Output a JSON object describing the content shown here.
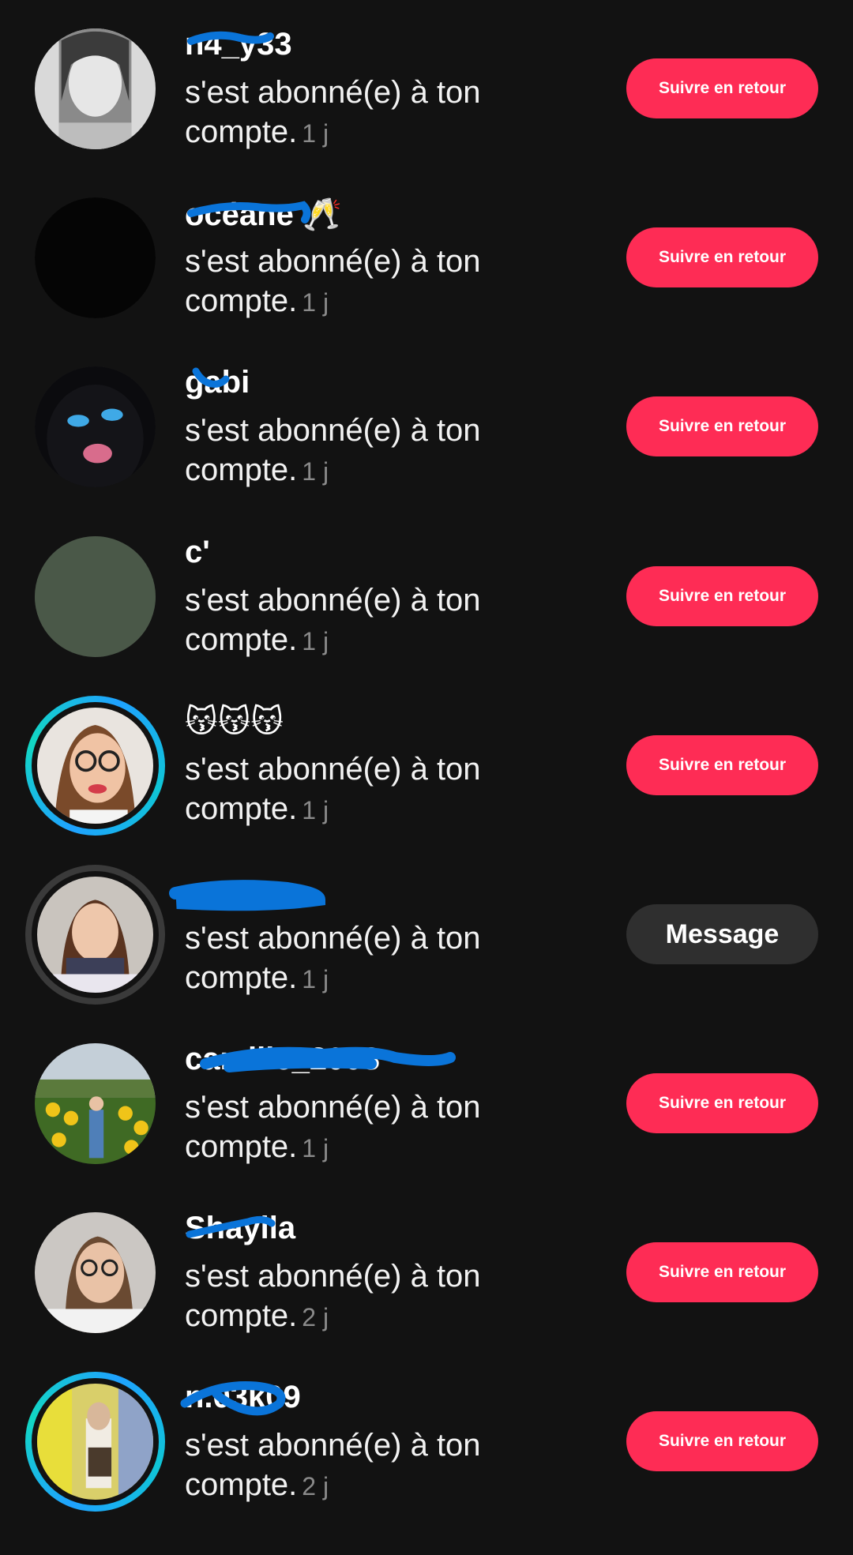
{
  "notifications": [
    {
      "username": "n4_y33",
      "action": "s'est abonné(e) à ton compte.",
      "time": "1 j",
      "button_label": "Suivre en retour",
      "button_type": "follow",
      "avatar_ring": "none"
    },
    {
      "username": "océane",
      "action": "s'est abonné(e) à ton compte.",
      "time": "1 j",
      "button_label": "Suivre en retour",
      "button_type": "follow",
      "avatar_ring": "none"
    },
    {
      "username": "gabi",
      "action": "s'est abonné(e) à ton compte.",
      "time": "1 j",
      "button_label": "Suivre en retour",
      "button_type": "follow",
      "avatar_ring": "none"
    },
    {
      "username": "c'",
      "action": "s'est abonné(e) à ton compte.",
      "time": "1 j",
      "button_label": "Suivre en retour",
      "button_type": "follow",
      "avatar_ring": "none"
    },
    {
      "username": "😽😽😽",
      "action": "s'est abonné(e) à ton compte.",
      "time": "1 j",
      "button_label": "Suivre en retour",
      "button_type": "follow",
      "avatar_ring": "story"
    },
    {
      "username": "",
      "action": "s'est abonné(e) à ton compte.",
      "time": "1 j",
      "button_label": "Message",
      "button_type": "message",
      "avatar_ring": "seen"
    },
    {
      "username": "camille_2008",
      "action": "s'est abonné(e) à ton compte.",
      "time": "1 j",
      "button_label": "Suivre en retour",
      "button_type": "follow",
      "avatar_ring": "none"
    },
    {
      "username": "Shaylla",
      "action": "s'est abonné(e) à ton compte.",
      "time": "2 j",
      "button_label": "Suivre en retour",
      "button_type": "follow",
      "avatar_ring": "none"
    },
    {
      "username": "n.03k09",
      "action": "s'est abonné(e) à ton compte.",
      "time": "2 j",
      "button_label": "Suivre en retour",
      "button_type": "follow",
      "avatar_ring": "story"
    }
  ],
  "colors": {
    "background": "#121212",
    "follow_button": "#fe2c55",
    "message_button": "#2f2f2f",
    "redaction_scribble": "#0a74d9",
    "story_ring": "#1fa2ff"
  }
}
